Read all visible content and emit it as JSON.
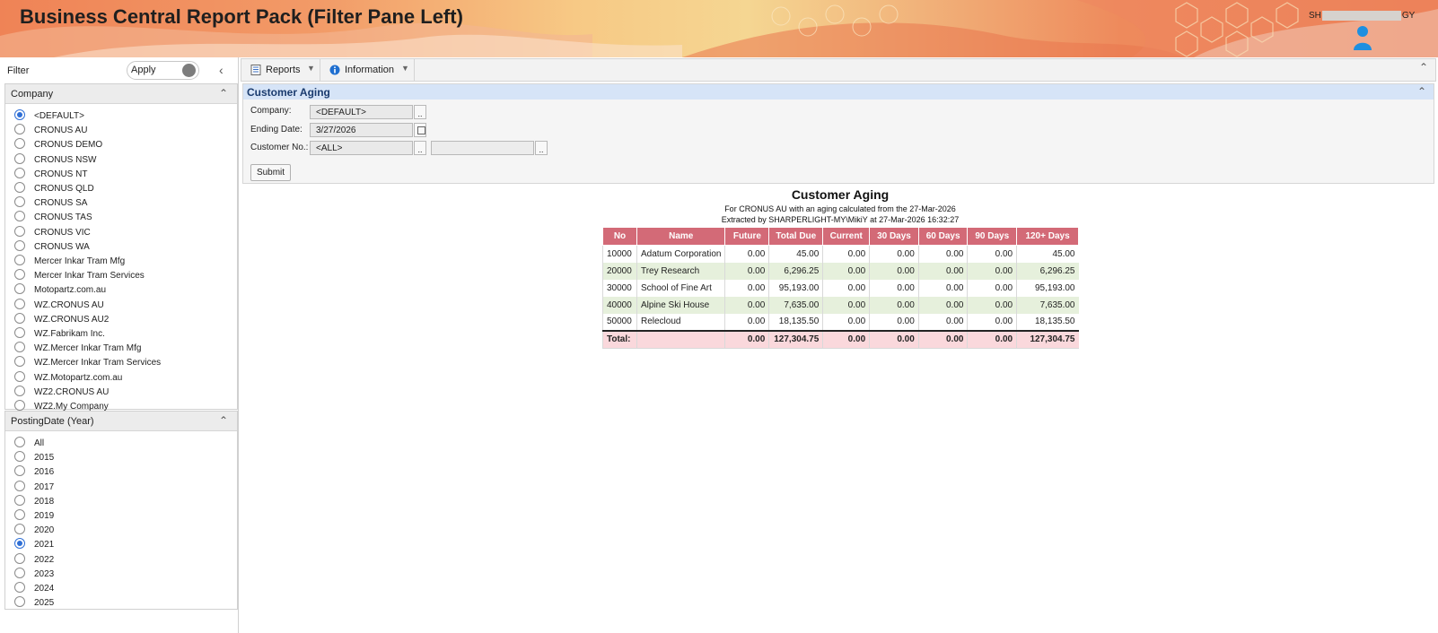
{
  "header": {
    "title": "Business Central Report Pack (Filter Pane Left)",
    "user_prefix": "SH",
    "user_suffix": "GY",
    "user_icon": "user-icon"
  },
  "filter_pane": {
    "label": "Filter",
    "apply_label": "Apply",
    "collapse_icon": "chevron-left-icon",
    "company": {
      "title": "Company",
      "selected": "<DEFAULT>",
      "options": [
        "<DEFAULT>",
        "CRONUS AU",
        "CRONUS DEMO",
        "CRONUS NSW",
        "CRONUS NT",
        "CRONUS QLD",
        "CRONUS SA",
        "CRONUS TAS",
        "CRONUS VIC",
        "CRONUS WA",
        "Mercer Inkar Tram Mfg",
        "Mercer Inkar Tram Services",
        "Motopartz.com.au",
        "WZ.CRONUS AU",
        "WZ.CRONUS AU2",
        "WZ.Fabrikam Inc.",
        "WZ.Mercer Inkar Tram Mfg",
        "WZ.Mercer Inkar Tram Services",
        "WZ.Motopartz.com.au",
        "WZ2.CRONUS AU",
        "WZ2.My Company"
      ]
    },
    "posting_date": {
      "title": "PostingDate (Year)",
      "selected": "2021",
      "options": [
        "All",
        "2015",
        "2016",
        "2017",
        "2018",
        "2019",
        "2020",
        "2021",
        "2022",
        "2023",
        "2024",
        "2025"
      ]
    }
  },
  "toolbar": {
    "reports_label": "Reports",
    "information_label": "Information"
  },
  "criteria": {
    "title": "Customer Aging",
    "company_label": "Company:",
    "company_value": "<DEFAULT>",
    "ending_date_label": "Ending Date:",
    "ending_date_value": "3/27/2026",
    "customer_label": "Customer No.:",
    "customer_value": "<ALL>",
    "customer_value2": "",
    "lookup_label": "..",
    "submit_label": "Submit"
  },
  "report": {
    "title": "Customer Aging",
    "subtitle1": "For CRONUS AU with an aging calculated from the 27-Mar-2026",
    "subtitle2": "Extracted by SHARPERLIGHT-MY\\MikiY at 27-Mar-2026 16:32:27",
    "header_color": "#d36a77",
    "alt_row_color": "#e6f0dc",
    "total_row_color": "#fad8dc",
    "columns": [
      "No",
      "Name",
      "Future",
      "Total Due",
      "Current",
      "30 Days",
      "60 Days",
      "90 Days",
      "120+ Days"
    ],
    "rows": [
      [
        "10000",
        "Adatum Corporation",
        "0.00",
        "45.00",
        "0.00",
        "0.00",
        "0.00",
        "0.00",
        "45.00"
      ],
      [
        "20000",
        "Trey Research",
        "0.00",
        "6,296.25",
        "0.00",
        "0.00",
        "0.00",
        "0.00",
        "6,296.25"
      ],
      [
        "30000",
        "School of Fine Art",
        "0.00",
        "95,193.00",
        "0.00",
        "0.00",
        "0.00",
        "0.00",
        "95,193.00"
      ],
      [
        "40000",
        "Alpine Ski House",
        "0.00",
        "7,635.00",
        "0.00",
        "0.00",
        "0.00",
        "0.00",
        "7,635.00"
      ],
      [
        "50000",
        "Relecloud",
        "0.00",
        "18,135.50",
        "0.00",
        "0.00",
        "0.00",
        "0.00",
        "18,135.50"
      ]
    ],
    "total": [
      "Total:",
      "",
      "0.00",
      "127,304.75",
      "0.00",
      "0.00",
      "0.00",
      "0.00",
      "127,304.75"
    ]
  }
}
